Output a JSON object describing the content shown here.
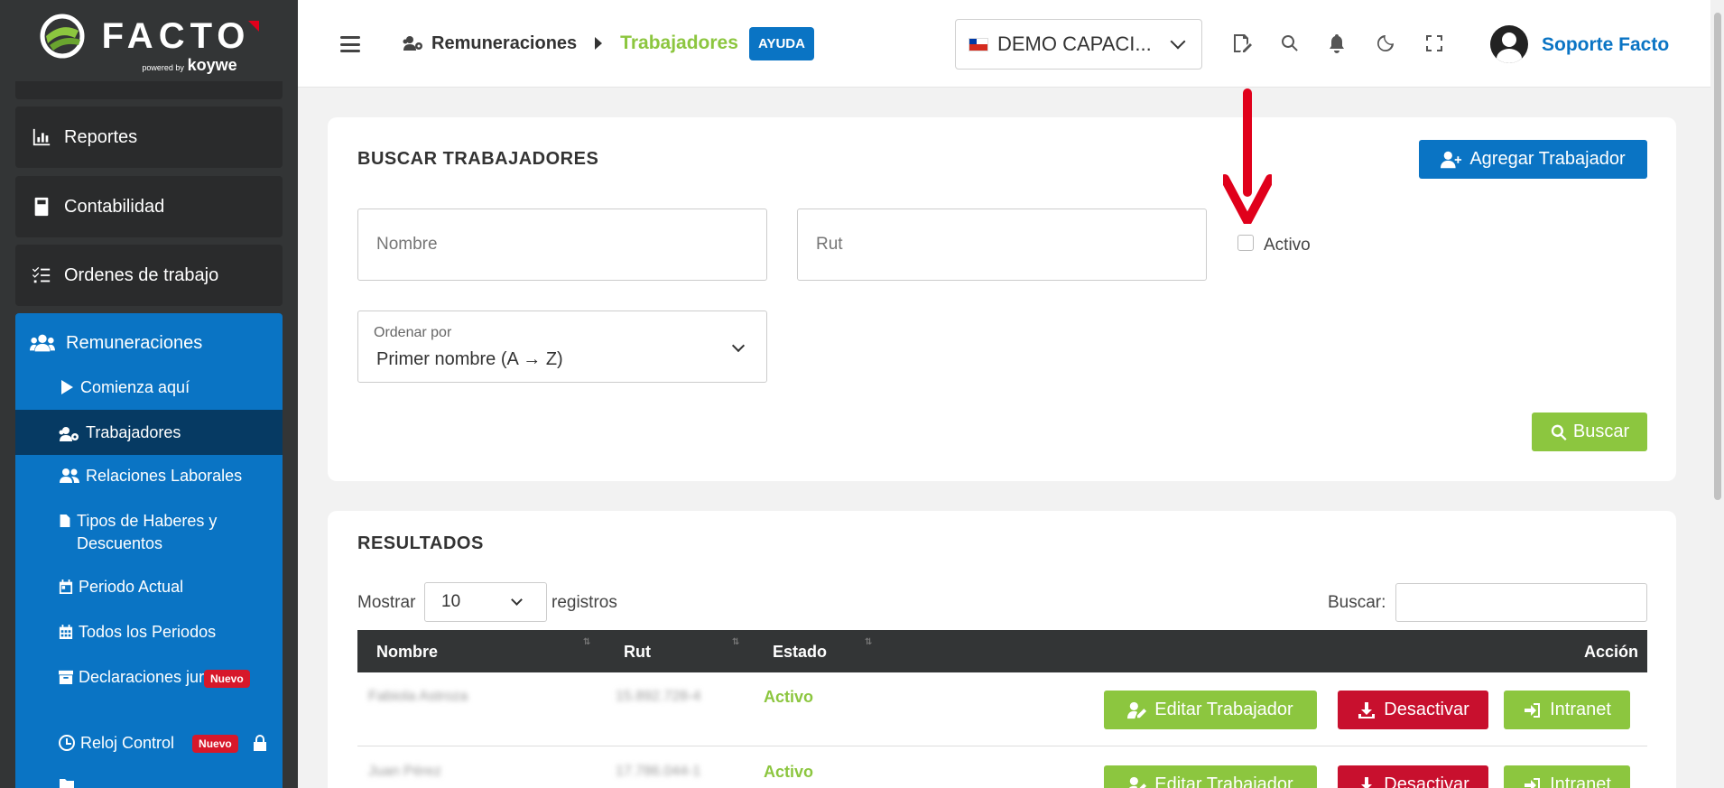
{
  "sidebar": {
    "logo": {
      "name": "FACTO",
      "powered": "powered by",
      "brand": "koywe"
    },
    "items": [
      {
        "label": "Reportes",
        "icon": "chart-icon"
      },
      {
        "label": "Contabilidad",
        "icon": "calculator-icon"
      },
      {
        "label": "Ordenes de trabajo",
        "icon": "checklist-icon"
      }
    ],
    "section": {
      "label": "Remuneraciones",
      "icon": "users-icon"
    },
    "subitems": [
      {
        "label": "Comienza aquí",
        "icon": "play-icon"
      },
      {
        "label": "Trabajadores",
        "icon": "users-gear-icon",
        "active": true
      },
      {
        "label": "Relaciones Laborales",
        "icon": "users-icon"
      },
      {
        "label": "Tipos de Haberes y Descuentos",
        "icon": "file-icon"
      },
      {
        "label": "Periodo Actual",
        "icon": "calendar-icon"
      },
      {
        "label": "Todos los Periodos",
        "icon": "calendar-grid-icon"
      },
      {
        "label": "Declaraciones juradas",
        "icon": "archive-icon",
        "badge": "Nuevo"
      },
      {
        "label": "Reloj Control",
        "icon": "clock-icon",
        "badge": "Nuevo"
      }
    ]
  },
  "header": {
    "breadcrumb": {
      "section": "Remuneraciones",
      "current": "Trabajadores"
    },
    "help_label": "AYUDA",
    "company": "DEMO CAPACI...",
    "user": "Soporte Facto"
  },
  "search": {
    "title": "BUSCAR TRABAJADORES",
    "add_button": "Agregar Trabajador",
    "name_placeholder": "Nombre",
    "rut_placeholder": "Rut",
    "active_label": "Activo",
    "order_label": "Ordenar por",
    "order_value": "Primer nombre (A → Z)",
    "search_button": "Buscar"
  },
  "results": {
    "title": "RESULTADOS",
    "show_label": "Mostrar",
    "page_length": "10",
    "records_label": "registros",
    "filter_label": "Buscar:",
    "columns": [
      "Nombre",
      "Rut",
      "Estado",
      "Acción"
    ],
    "rows": [
      {
        "name": "Fabiola Astroza",
        "rut": "15.892.728-4",
        "status": "Activo"
      },
      {
        "name": "Juan Pérez",
        "rut": "17.786.044-1",
        "status": "Activo"
      }
    ],
    "actions": {
      "edit": "Editar Trabajador",
      "deactivate": "Desactivar",
      "intranet": "Intranet"
    }
  },
  "colors": {
    "primary": "#0a74c4",
    "success": "#8cc63f",
    "danger": "#c8102e",
    "sidebar": "#333536",
    "arrow": "#e0001b"
  }
}
